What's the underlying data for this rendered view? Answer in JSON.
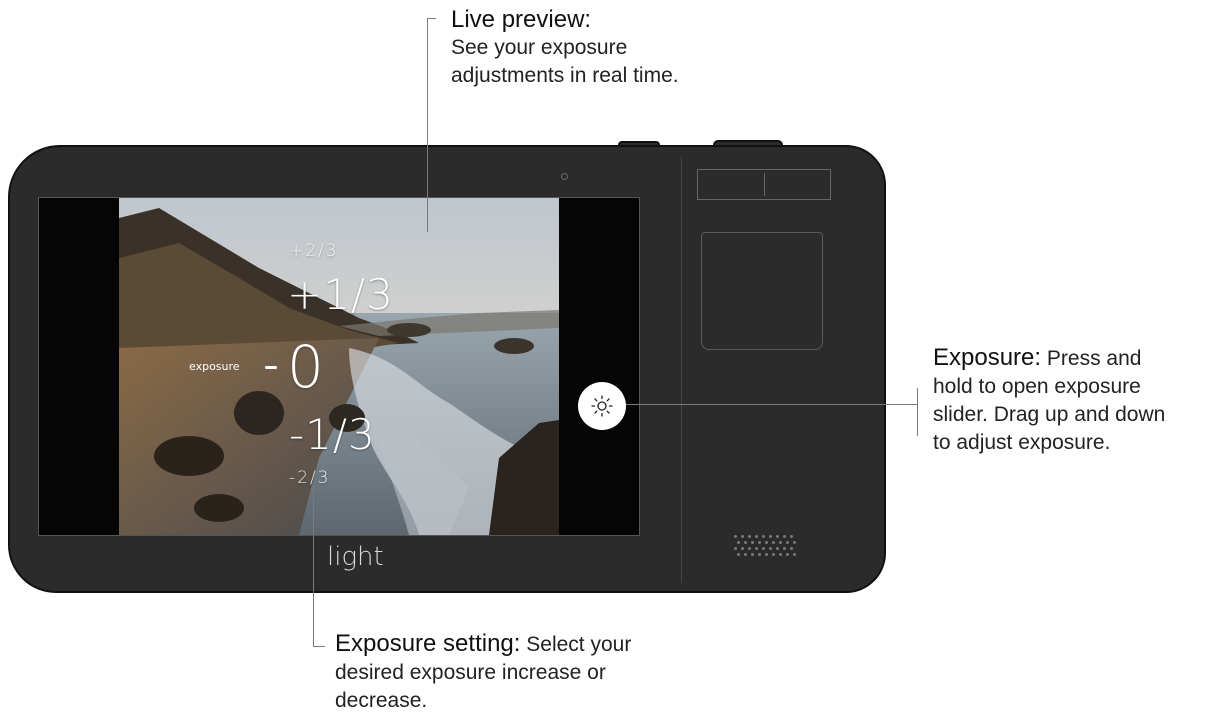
{
  "annotations": {
    "live_preview": {
      "title": "Live preview:",
      "body_line1": "See your exposure",
      "body_line2": "adjustments in real time."
    },
    "exposure": {
      "title": "Exposure:",
      "line1": "Press and",
      "line2": "hold to open exposure",
      "line3": "slider. Drag up and down",
      "line4": "to adjust exposure."
    },
    "exposure_setting": {
      "title": "Exposure setting:",
      "line1": "Select your",
      "line2": "desired exposure increase or",
      "line3": "decrease."
    }
  },
  "screen": {
    "slider_label": "exposure",
    "values": [
      "+2/3",
      "+1/3",
      "0",
      "-1/3",
      "-2/3"
    ],
    "selected_value": "0"
  },
  "camera": {
    "brand": "light"
  },
  "icons": {
    "exposure_button": "sun-icon"
  },
  "colors": {
    "camera_body": "#2b2b2b",
    "screen_border": "#555555",
    "leader_line": "#7a7a7a",
    "exposure_button": "#ffffff"
  }
}
